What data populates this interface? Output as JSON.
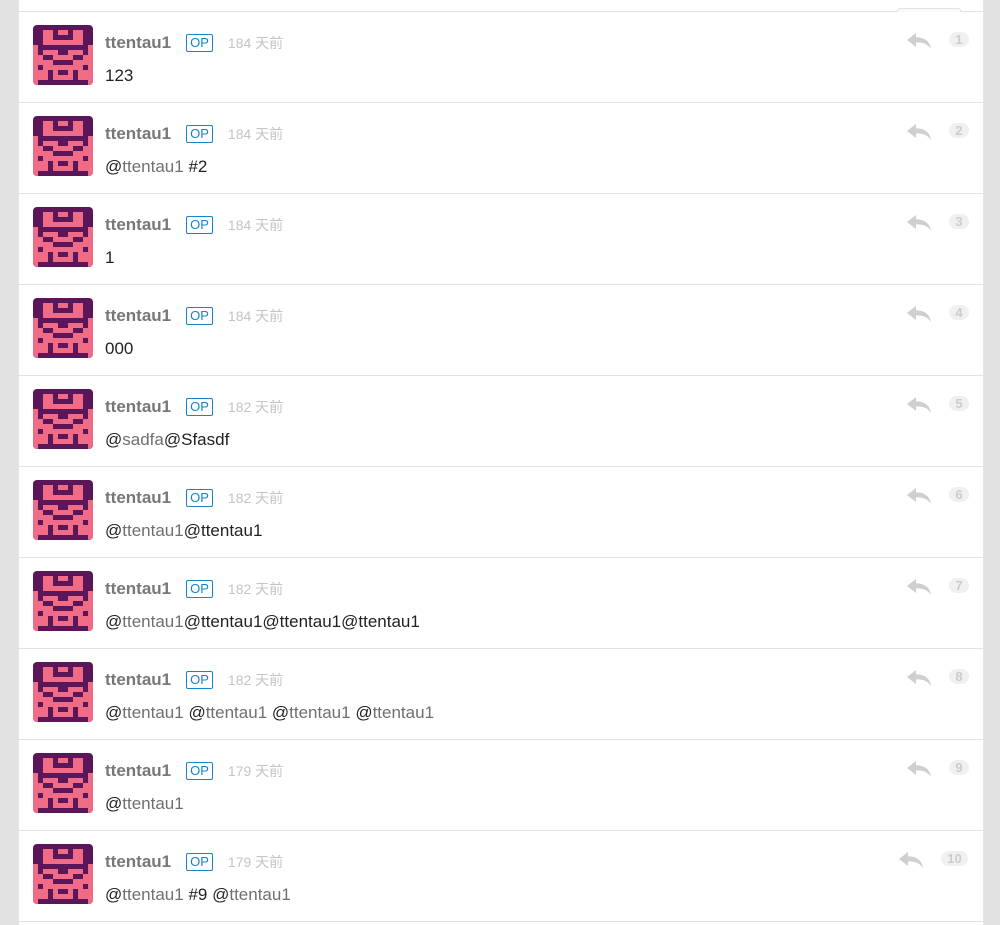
{
  "replies": [
    {
      "username": "ttentau1",
      "op_badge": "OP",
      "time": "184 天前",
      "floor": "1",
      "content": [
        {
          "t": "123",
          "mention": false
        }
      ]
    },
    {
      "username": "ttentau1",
      "op_badge": "OP",
      "time": "184 天前",
      "floor": "2",
      "content": [
        {
          "t": "@",
          "mention": false
        },
        {
          "t": "ttentau1",
          "mention": true
        },
        {
          "t": " #2",
          "mention": false
        }
      ]
    },
    {
      "username": "ttentau1",
      "op_badge": "OP",
      "time": "184 天前",
      "floor": "3",
      "content": [
        {
          "t": "1",
          "mention": false
        }
      ]
    },
    {
      "username": "ttentau1",
      "op_badge": "OP",
      "time": "184 天前",
      "floor": "4",
      "content": [
        {
          "t": "000",
          "mention": false
        }
      ]
    },
    {
      "username": "ttentau1",
      "op_badge": "OP",
      "time": "182 天前",
      "floor": "5",
      "content": [
        {
          "t": "@",
          "mention": false
        },
        {
          "t": "sadfa",
          "mention": true
        },
        {
          "t": "@Sfasdf",
          "mention": false
        }
      ]
    },
    {
      "username": "ttentau1",
      "op_badge": "OP",
      "time": "182 天前",
      "floor": "6",
      "content": [
        {
          "t": "@",
          "mention": false
        },
        {
          "t": "ttentau1",
          "mention": true
        },
        {
          "t": "@ttentau1",
          "mention": false
        }
      ]
    },
    {
      "username": "ttentau1",
      "op_badge": "OP",
      "time": "182 天前",
      "floor": "7",
      "content": [
        {
          "t": "@",
          "mention": false
        },
        {
          "t": "ttentau1",
          "mention": true
        },
        {
          "t": "@ttentau1@ttentau1@ttentau1",
          "mention": false
        }
      ]
    },
    {
      "username": "ttentau1",
      "op_badge": "OP",
      "time": "182 天前",
      "floor": "8",
      "content": [
        {
          "t": "@",
          "mention": false
        },
        {
          "t": "ttentau1",
          "mention": true
        },
        {
          "t": " @",
          "mention": false
        },
        {
          "t": "ttentau1",
          "mention": true
        },
        {
          "t": " @",
          "mention": false
        },
        {
          "t": "ttentau1",
          "mention": true
        },
        {
          "t": " @",
          "mention": false
        },
        {
          "t": "ttentau1",
          "mention": true
        }
      ]
    },
    {
      "username": "ttentau1",
      "op_badge": "OP",
      "time": "179 天前",
      "floor": "9",
      "content": [
        {
          "t": "@",
          "mention": false
        },
        {
          "t": "ttentau1",
          "mention": true
        }
      ]
    },
    {
      "username": "ttentau1",
      "op_badge": "OP",
      "time": "179 天前",
      "floor": "10",
      "content": [
        {
          "t": "@",
          "mention": false
        },
        {
          "t": "ttentau1",
          "mention": true
        },
        {
          "t": " #9 @",
          "mention": false
        },
        {
          "t": "ttentau1",
          "mention": true
        }
      ]
    }
  ],
  "colors": {
    "avatar_bg": "#5a1659",
    "avatar_fg": "#f06b86",
    "op_badge": "#1484cd",
    "mention": "#6f6f6f"
  },
  "icons": {
    "reply": "reply-arrow-icon",
    "avatar": "identicon-avatar"
  }
}
